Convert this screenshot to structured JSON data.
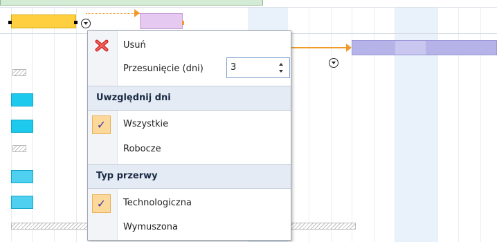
{
  "gantt": {
    "task_colors": {
      "yellow": "#ffcf40",
      "pink": "#e6c9f1",
      "lavender": "#b5b3e8",
      "cyan": "#1dc9ed",
      "link": "#f09b2a"
    }
  },
  "menu": {
    "delete": {
      "label": "Usuń",
      "icon": "delete-icon"
    },
    "offset": {
      "label": "Przesunięcie (dni)",
      "value": "3"
    },
    "days_header": "Uwzględnij dni",
    "days_options": [
      {
        "label": "Wszystkie",
        "checked": true
      },
      {
        "label": "Robocze",
        "checked": false
      }
    ],
    "break_header": "Typ przerwy",
    "break_options": [
      {
        "label": "Technologiczna",
        "checked": true
      },
      {
        "label": "Wymuszona",
        "checked": false
      }
    ],
    "check_glyph": "✓"
  }
}
